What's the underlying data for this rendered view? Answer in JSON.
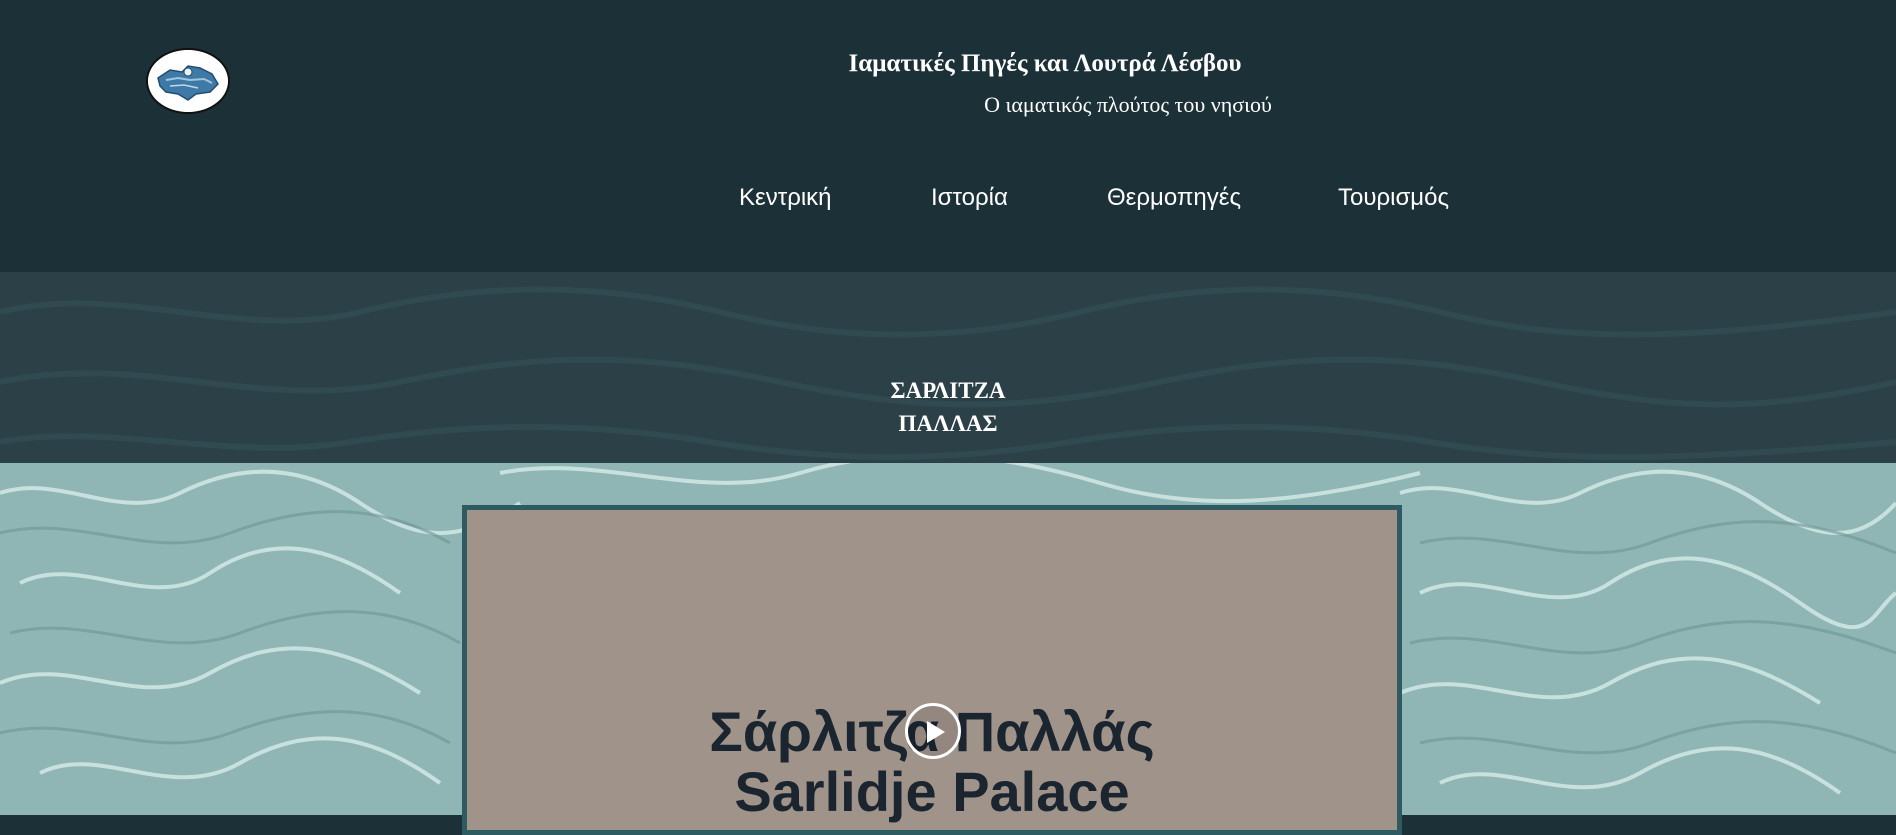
{
  "header": {
    "title": "Ιαματικές Πηγές και Λουτρά Λέσβου",
    "subtitle": "Ο ιαματικός πλούτος του νησιού",
    "logo_icon": "lesvos-map-logo-icon"
  },
  "nav": {
    "items": [
      {
        "label": "Κεντρική"
      },
      {
        "label": "Ιστορία"
      },
      {
        "label": "Θερμοπηγές"
      },
      {
        "label": "Τουρισμός"
      }
    ]
  },
  "band": {
    "title_line1": "ΣΑΡΛΙΤΖΑ",
    "title_line2": "ΠΑΛΛΑΣ"
  },
  "video": {
    "title_line1": "Σάρλιτζα Παλλάς",
    "title_line2": "Sarlidje Palace",
    "play_icon": "play-icon"
  },
  "colors": {
    "header_bg": "#1c3038",
    "band_bg": "#2b4047",
    "water": "#8fb5b4",
    "video_bg": "#a0938a",
    "video_border": "#2e5a61",
    "video_text": "#1b2530"
  }
}
